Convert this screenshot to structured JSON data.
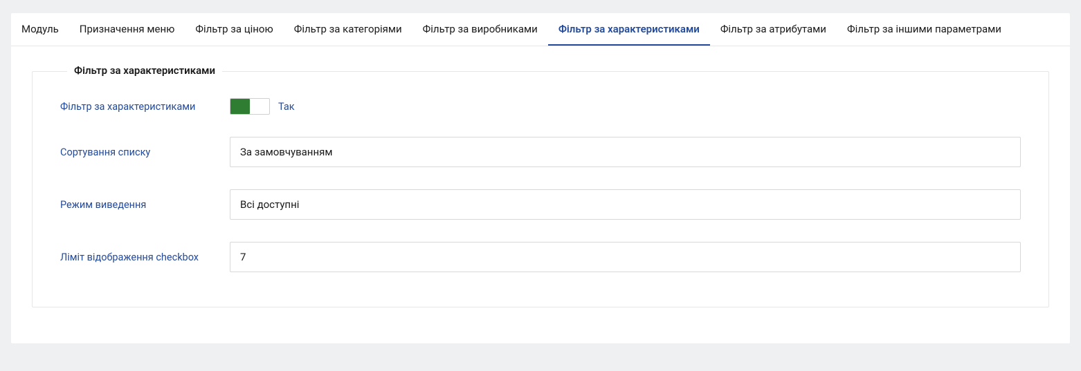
{
  "tabs": [
    {
      "label": "Модуль"
    },
    {
      "label": "Призначення меню"
    },
    {
      "label": "Фільтр за ціною"
    },
    {
      "label": "Фільтр за категоріями"
    },
    {
      "label": "Фільтр за виробниками"
    },
    {
      "label": "Фільтр за характеристиками",
      "active": true
    },
    {
      "label": "Фільтр за атрибутами"
    },
    {
      "label": "Фільтр за іншими параметрами"
    }
  ],
  "fieldset": {
    "legend": "Фільтр за характеристиками",
    "rows": {
      "enable": {
        "label": "Фільтр за характеристиками",
        "toggle_state": "on",
        "toggle_text": "Так"
      },
      "sort": {
        "label": "Сортування списку",
        "value": "За замовчуванням"
      },
      "mode": {
        "label": "Режим виведення",
        "value": "Всі доступні"
      },
      "limit": {
        "label": "Ліміт відображення checkbox",
        "value": "7"
      }
    }
  }
}
